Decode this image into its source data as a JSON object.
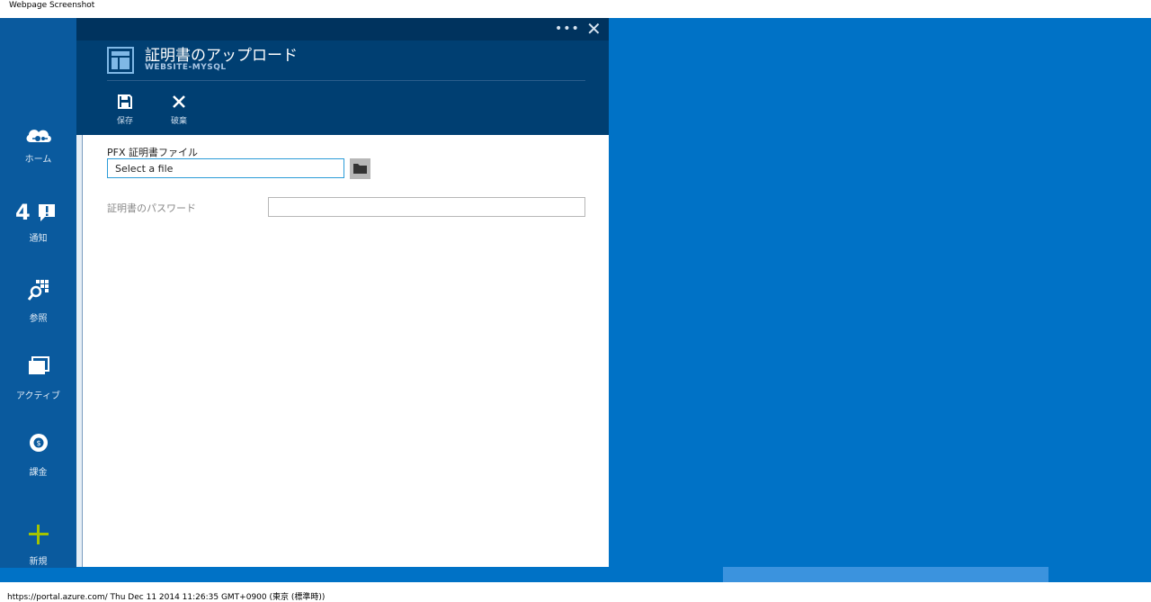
{
  "window": {
    "title": "Webpage Screenshot"
  },
  "sidebar": {
    "items": [
      {
        "label": "ホーム",
        "icon": "cloud-icon"
      },
      {
        "label": "通知",
        "icon": "notification-icon",
        "badge": "4"
      },
      {
        "label": "参照",
        "icon": "browse-icon"
      },
      {
        "label": "アクティブ",
        "icon": "windows-icon"
      },
      {
        "label": "課金",
        "icon": "billing-icon"
      }
    ],
    "new": {
      "label": "新規",
      "icon": "plus-icon"
    }
  },
  "blade": {
    "title": "証明書のアップロード",
    "subtitle": "WEBSITE-MYSQL",
    "dots": "•••",
    "close": "✕",
    "commands": [
      {
        "label": "保存",
        "icon": "save-icon"
      },
      {
        "label": "破棄",
        "icon": "discard-icon"
      }
    ],
    "pfx_label": "PFX 証明書ファイル",
    "file_placeholder": "Select a file",
    "password_label": "証明書のパスワード",
    "password_value": ""
  },
  "status": {
    "text": "https://portal.azure.com/ Thu Dec 11 2014 11:26:35 GMT+0900 (東京 (標準時))"
  },
  "colors": {
    "background": "#0072c6",
    "blade_header": "#003f72",
    "sidebar": "#0a5a9e",
    "accent_new": "#a4c400"
  }
}
